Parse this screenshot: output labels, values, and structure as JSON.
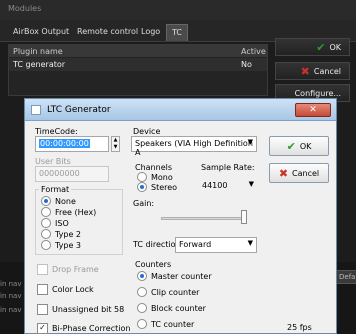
{
  "modules": {
    "title": "Modules",
    "tabs": [
      "AirBox Output",
      "Remote control",
      "Logo",
      "TC"
    ],
    "active_tab": "TC",
    "list": {
      "col_name": "Plugin name",
      "col_active": "Active",
      "row_name": "TC generator",
      "row_active": "No"
    },
    "buttons": {
      "ok": "OK",
      "cancel": "Cancel",
      "configure": "Configure..."
    },
    "side_labels": [
      "in nav",
      "in nav",
      "in nav"
    ],
    "defaults_label": "Defa"
  },
  "dialog": {
    "title": "LTC Generator",
    "timecode": {
      "label": "TimeCode:",
      "value": "00:00:00:00"
    },
    "user_bits": {
      "label": "User Bits",
      "value": "00000000"
    },
    "format": {
      "label": "Format",
      "options": [
        "None",
        "Free (Hex)",
        "ISO",
        "Type 2",
        "Type 3"
      ],
      "selected": "None"
    },
    "device": {
      "label": "Device",
      "value": "Speakers (VIA High Definition A"
    },
    "channels": {
      "label": "Channels",
      "options": [
        "Mono",
        "Stereo"
      ],
      "selected": "Stereo"
    },
    "sample_rate": {
      "label": "Sample Rate:",
      "value": "44100"
    },
    "gain": {
      "label": "Gain:",
      "level": 0.95
    },
    "tc_direction": {
      "label": "TC direction",
      "value": "Forward"
    },
    "checks": {
      "drop_frame": "Drop Frame",
      "color_lock": "Color Lock",
      "unassigned": "Unassigned bit 58",
      "biphase": "Bi-Phase Correction"
    },
    "counters": {
      "label": "Counters",
      "options": [
        "Master counter",
        "Clip counter",
        "Block counter",
        "TC counter"
      ],
      "selected": "Master counter"
    },
    "fps": "25 fps",
    "ok_label": "OK",
    "cancel_label": "Cancel"
  },
  "colors": {
    "ok_check": "#2e9a2e",
    "cancel_x": "#c8322a",
    "selection": "#3399ff"
  }
}
